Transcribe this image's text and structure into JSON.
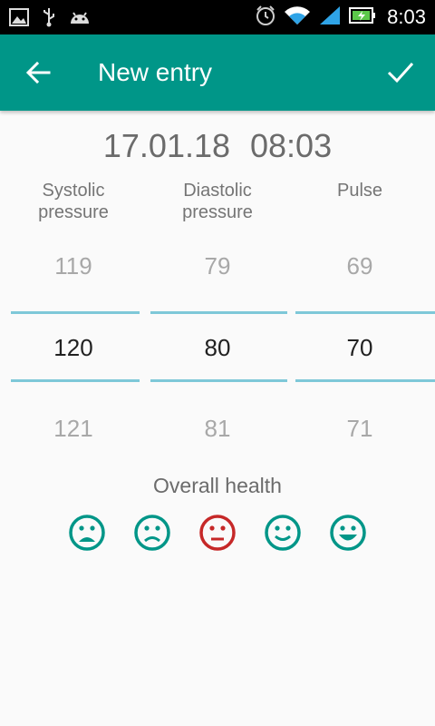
{
  "status_bar": {
    "time": "8:03",
    "icons": [
      "image-icon",
      "usb-icon",
      "android-icon",
      "alarm-icon",
      "wifi-icon",
      "signal-icon",
      "battery-charging-icon"
    ]
  },
  "app_bar": {
    "title": "New entry",
    "back_icon": "arrow-back-icon",
    "confirm_icon": "check-icon",
    "color": "#009688"
  },
  "entry": {
    "date": "17.01.18",
    "time": "08:03"
  },
  "pickers": {
    "systolic": {
      "label": "Systolic\npressure",
      "label_line1": "Systolic",
      "label_line2": "pressure",
      "prev": "119",
      "current": "120",
      "next": "121"
    },
    "diastolic": {
      "label_line1": "Diastolic",
      "label_line2": "pressure",
      "prev": "79",
      "current": "80",
      "next": "81"
    },
    "pulse": {
      "label_line1": "Pulse",
      "label_line2": "",
      "prev": "69",
      "current": "70",
      "next": "71"
    }
  },
  "health": {
    "label": "Overall health",
    "faces": [
      "very-sad-face-icon",
      "sad-face-icon",
      "neutral-face-icon",
      "smile-face-icon",
      "happy-face-icon"
    ],
    "selected_index": 2,
    "face_color": "#009688",
    "selected_color": "#c62828"
  }
}
